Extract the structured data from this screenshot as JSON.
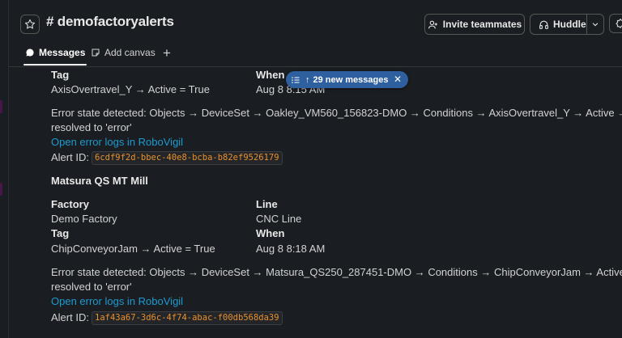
{
  "header": {
    "channel": "# demofactoryalerts",
    "invite_label": "Invite teammates",
    "huddle_label": "Huddle"
  },
  "tabs": [
    {
      "label": "Messages",
      "active": true
    },
    {
      "label": "Add canvas",
      "active": false
    }
  ],
  "new_messages_pill": {
    "label": "29 new messages"
  },
  "messages": [
    {
      "tag_label": "Tag",
      "tag_value": "AxisOvertravel_Y → Active = True",
      "when_label": "When",
      "when_value": "Aug 8 8:15 AM",
      "error_line1": "Error state detected: Objects → DeviceSet → Oakley_VM560_156823-DMO → Conditions → AxisOvertravel_Y → Active → Ac",
      "error_line2": "resolved to 'error'",
      "link": "Open error logs in RoboVigil",
      "alert_label": "Alert ID:",
      "alert_id": "6cdf9f2d-bbec-40e8-bcba-b82ef9526179"
    },
    {
      "machine": "Matsura QS MT Mill",
      "factory_label": "Factory",
      "factory_value": "Demo Factory",
      "line_label": "Line",
      "line_value": "CNC Line",
      "tag_label": "Tag",
      "tag_value": "ChipConveyorJam → Active = True",
      "when_label": "When",
      "when_value": "Aug 8 8:18 AM",
      "error_line1": "Error state detected: Objects → DeviceSet → Matsura_QS250_287451-DMO → Conditions → ChipConveyorJam → Active → A",
      "error_line2": "resolved to 'error'",
      "link": "Open error logs in RoboVigil",
      "alert_label": "Alert ID:",
      "alert_id": "1af43a67-3d6c-4f74-abac-f00db568da39"
    }
  ],
  "colors": {
    "background": "#1a1d21",
    "link": "#1d9bd1",
    "code": "#e8912d",
    "pill": "#2e5f9e"
  }
}
